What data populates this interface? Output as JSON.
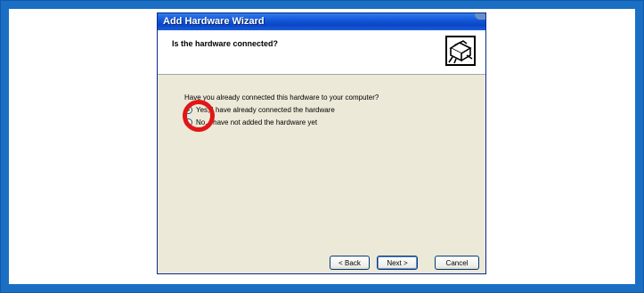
{
  "window": {
    "title": "Add Hardware Wizard"
  },
  "header": {
    "title": "Is the hardware connected?",
    "icon": "hardware-wizard-icon"
  },
  "body": {
    "question": "Have you already connected this hardware to your computer?",
    "options": [
      {
        "label": "Yes, I have already connected the hardware",
        "selected": true
      },
      {
        "label": "No, I have not added the hardware yet",
        "selected": false
      }
    ]
  },
  "buttons": {
    "back": "< Back",
    "next": "Next >",
    "cancel": "Cancel"
  },
  "colors": {
    "frame_border": "#1a6fc4",
    "highlight_ring": "#e21616",
    "titlebar": "#0b46c4",
    "dialog_background": "#ece9d8"
  }
}
